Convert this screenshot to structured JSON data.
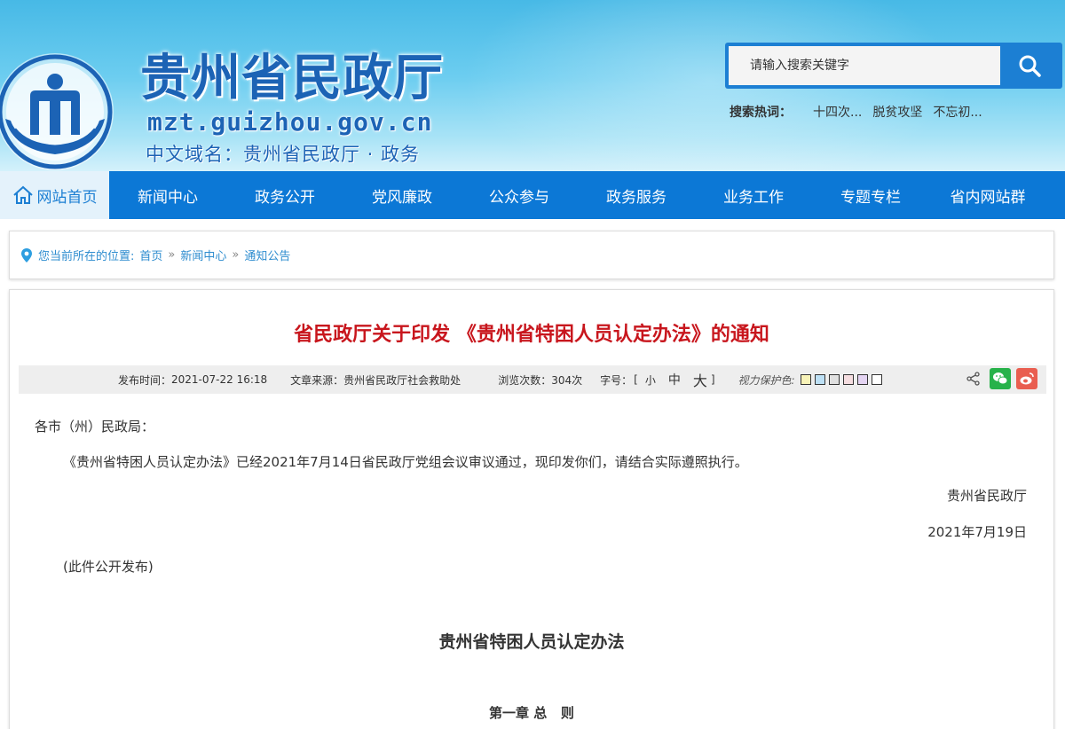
{
  "header": {
    "title": "贵州省民政厅",
    "domain": "mzt.guizhou.gov.cn",
    "cn_domain": "中文域名：贵州省民政厅 · 政务",
    "search": {
      "placeholder": "请输入搜索关键字"
    },
    "hot": {
      "label": "搜索热词：",
      "items": [
        "十四次...",
        "脱贫攻坚",
        "不忘初..."
      ]
    }
  },
  "nav": {
    "home": "网站首页",
    "items": [
      "新闻中心",
      "政务公开",
      "党风廉政",
      "公众参与",
      "政务服务",
      "业务工作",
      "专题专栏",
      "省内网站群"
    ]
  },
  "breadcrumb": {
    "prefix": "您当前所在的位置:",
    "items": [
      "首页",
      "新闻中心",
      "通知公告"
    ],
    "sep": "»"
  },
  "article": {
    "title": "省民政厅关于印发 《贵州省特困人员认定办法》的通知",
    "meta": {
      "time_label": "发布时间：",
      "time": "2021-07-22 16:18",
      "source_label": "文章来源：",
      "source": "贵州省民政厅社会救助处",
      "views_label": "浏览次数：",
      "views": "304次",
      "font_label": "字号：",
      "font_open": "[",
      "font_small": "小",
      "font_medium": "中",
      "font_large": "大",
      "font_close": "]",
      "eye_label": "视力保护色:"
    },
    "swatch_colors": [
      "#f8f3b8",
      "#bde0f5",
      "#e0e0e0",
      "#f5dde0",
      "#e4d4f2",
      "#ffffff"
    ],
    "greeting": "各市（州）民政局：",
    "body": "《贵州省特困人员认定办法》已经2021年7月14日省民政厅党组会议审议通过，现印发你们，请结合实际遵照执行。",
    "signature": "贵州省民政厅",
    "date": "2021年7月19日",
    "note": "(此件公开发布)",
    "doc_title": "贵州省特困人员认定办法",
    "chapter": "第一章 总   则"
  }
}
